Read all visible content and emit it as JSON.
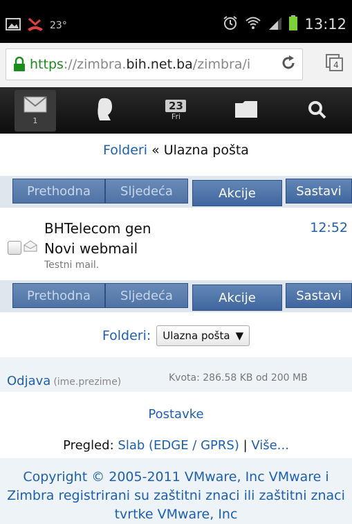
{
  "status_bar": {
    "temperature": "23°",
    "time": "13:12",
    "icons": [
      "image-icon",
      "missed-call-icon",
      "alarm-icon",
      "wifi-icon",
      "signal-icon",
      "battery-icon"
    ]
  },
  "browser": {
    "url_scheme": "https",
    "url_sep": "://zimbra.",
    "url_host": "bih.net.ba",
    "url_rest": "/zimbra/i",
    "tab_count": "4"
  },
  "nav": {
    "mail_count": "1",
    "cal_date": "23",
    "cal_day": "Fri"
  },
  "breadcrumb": {
    "folders_link": "Folderi",
    "separator": " « ",
    "current": "Ulazna pošta"
  },
  "toolbar": {
    "prev_label": "Prethodna",
    "next_label": "Sljedeća",
    "actions_label": "Akcije",
    "compose_label": "Sastavi"
  },
  "messages": [
    {
      "from": "BHTelecom gen",
      "time": "12:52",
      "subject": "Novi webmail",
      "fragment": "Testni mail."
    }
  ],
  "folder_select": {
    "label": "Folderi:",
    "value": "Ulazna pošta"
  },
  "account": {
    "logout_label": "Odjava",
    "user": "(ime.prezime)",
    "quota": "Kvota: 286.58 KB od 200 MB"
  },
  "settings_label": "Postavke",
  "view": {
    "label": "Pregled: ",
    "mode_link": "Slab (EDGE / GPRS)",
    "separator": " | ",
    "more_link": "Više..."
  },
  "copyright": "Copyright © 2005-2011 VMware, Inc VMware i Zimbra registrirani su zaštitni znaci ili zaštitni znaci tvrtke VMware, Inc",
  "colors": {
    "link": "#1d5fb0",
    "button": "#4f73a6",
    "nav_bar": "#111111"
  }
}
